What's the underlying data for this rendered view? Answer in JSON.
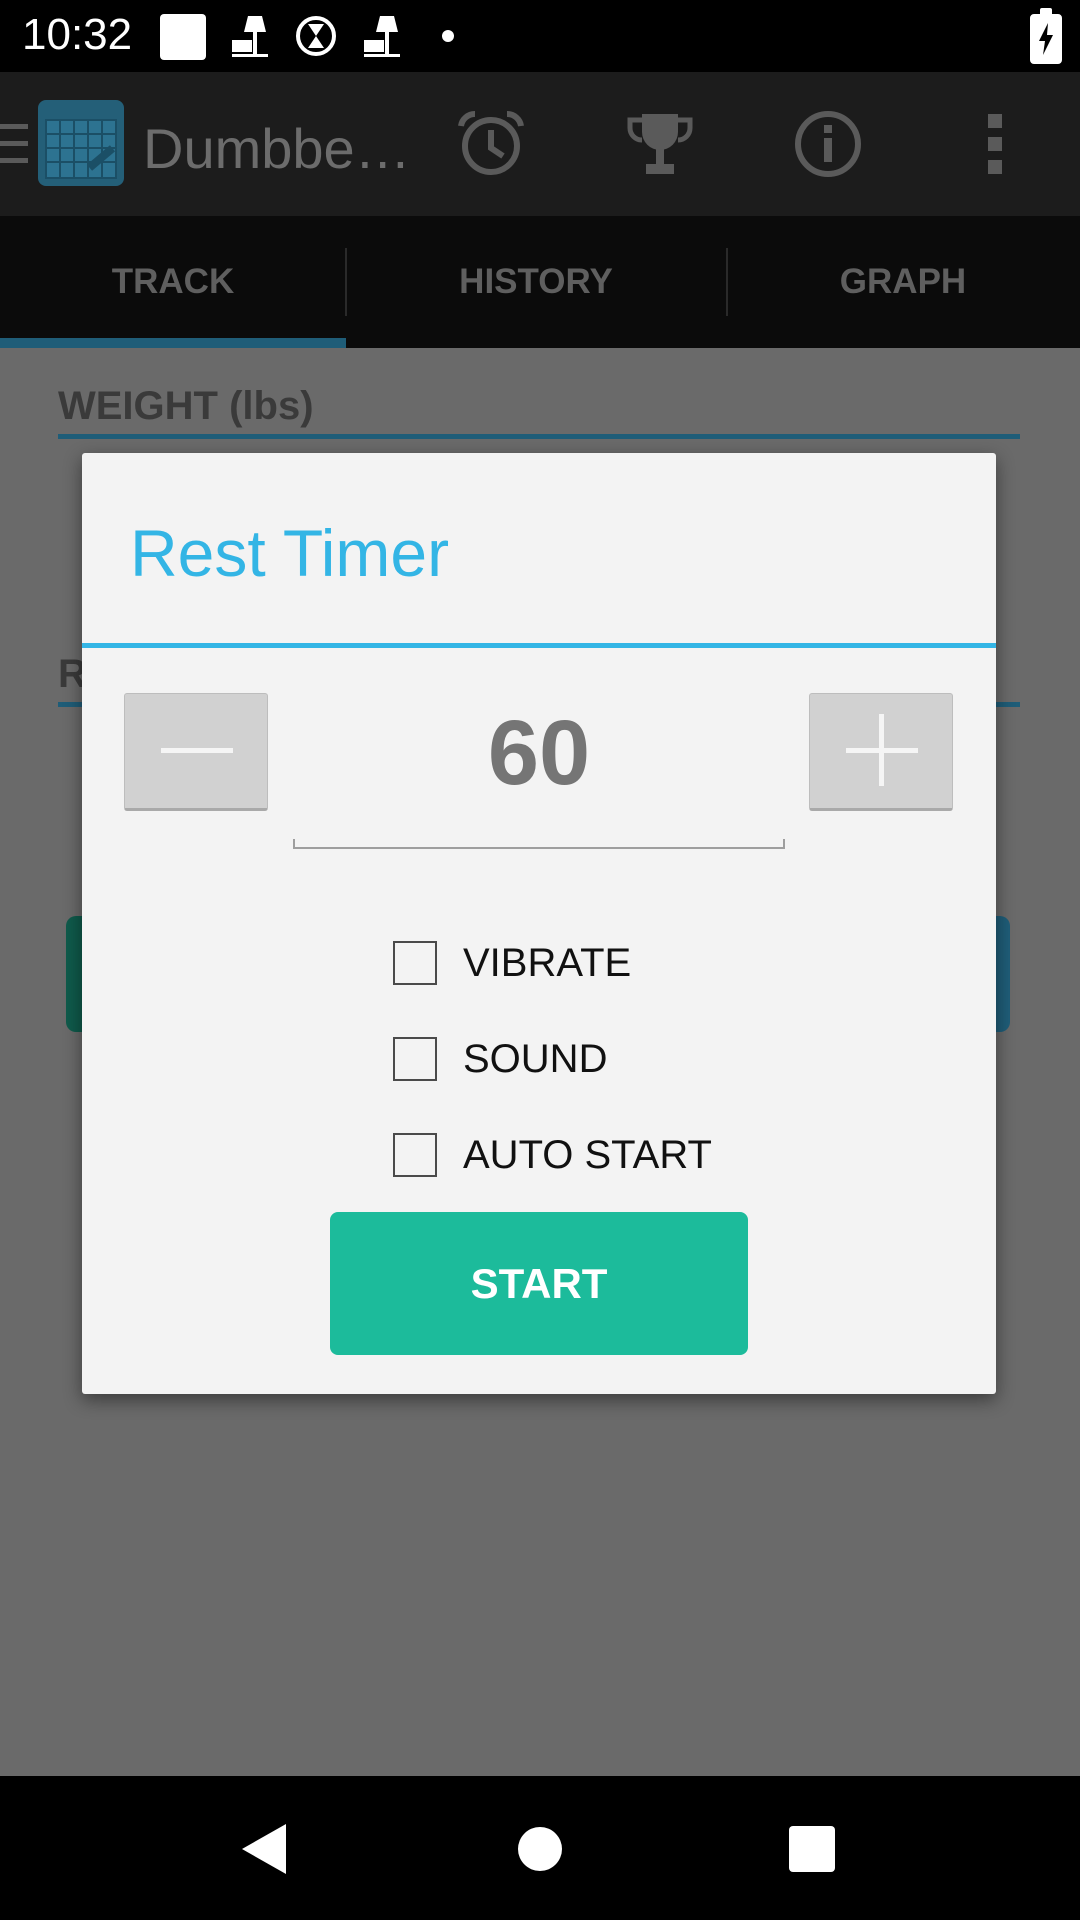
{
  "status_bar": {
    "time": "10:32",
    "icons": [
      "notification-square-icon",
      "lamp-icon",
      "hourglass-icon",
      "lamp-icon",
      "dot-icon"
    ],
    "battery": "battery-charging-icon"
  },
  "app_bar": {
    "title": "Dumbbe…",
    "actions": [
      "alarm-clock-icon",
      "trophy-icon",
      "info-icon",
      "overflow-menu-icon"
    ]
  },
  "tabs": [
    {
      "label": "TRACK",
      "selected": true
    },
    {
      "label": "HISTORY",
      "selected": false
    },
    {
      "label": "GRAPH",
      "selected": false
    }
  ],
  "background": {
    "weight_label": "WEIGHT (lbs)",
    "partial_label": "R"
  },
  "dialog": {
    "title": "Rest Timer",
    "value": "60",
    "options": [
      {
        "label": "VIBRATE",
        "checked": false
      },
      {
        "label": "SOUND",
        "checked": false
      },
      {
        "label": "AUTO START",
        "checked": false
      }
    ],
    "start_label": "START"
  },
  "colors": {
    "accent": "#33b5e5",
    "start_button": "#1cbb9b"
  }
}
